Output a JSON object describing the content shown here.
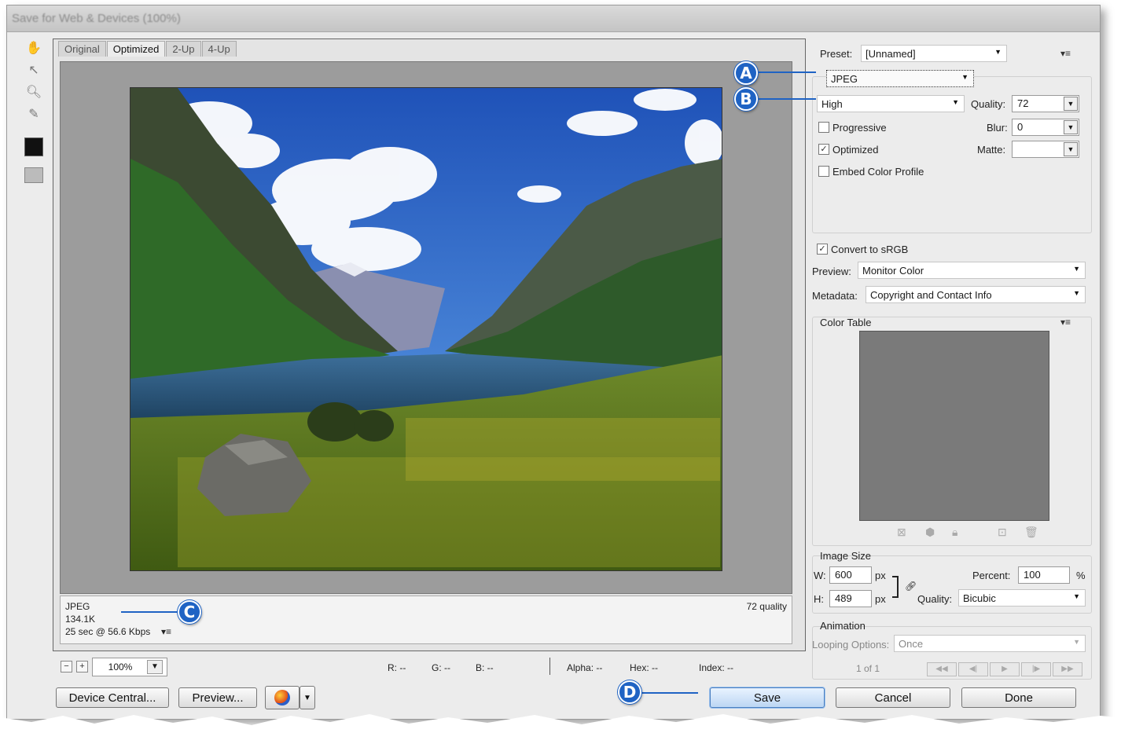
{
  "window": {
    "title": "Save for Web & Devices (100%)"
  },
  "tabs": [
    "Original",
    "Optimized",
    "2-Up",
    "4-Up"
  ],
  "info": {
    "format": "JPEG",
    "size": "134.1K",
    "time": "25 sec @ 56.6 Kbps",
    "quality_note": "72 quality"
  },
  "status_bar": {
    "zoom": "100%",
    "r": "R: --",
    "g": "G: --",
    "b": "B: --",
    "alpha": "Alpha: --",
    "hex": "Hex: --",
    "index": "Index: --"
  },
  "buttons": {
    "device_central": "Device Central...",
    "preview": "Preview...",
    "save": "Save",
    "cancel": "Cancel",
    "done": "Done"
  },
  "settings": {
    "preset_label": "Preset:",
    "preset_value": "[Unnamed]",
    "format": "JPEG",
    "quality_level": "High",
    "quality_label": "Quality:",
    "quality_value": "72",
    "blur_label": "Blur:",
    "blur_value": "0",
    "matte_label": "Matte:",
    "matte_value": "",
    "progressive": "Progressive",
    "optimized": "Optimized",
    "embed_profile": "Embed Color Profile",
    "convert_srgb": "Convert to sRGB",
    "preview_label": "Preview:",
    "preview_value": "Monitor Color",
    "metadata_label": "Metadata:",
    "metadata_value": "Copyright and Contact Info"
  },
  "color_table": {
    "title": "Color Table"
  },
  "image_size": {
    "title": "Image Size",
    "w_label": "W:",
    "w_value": "600",
    "h_label": "H:",
    "h_value": "489",
    "unit": "px",
    "percent_label": "Percent:",
    "percent_value": "100",
    "percent_unit": "%",
    "quality_label": "Quality:",
    "quality_value": "Bicubic"
  },
  "animation": {
    "title": "Animation",
    "looping_label": "Looping Options:",
    "looping_value": "Once",
    "frame": "1 of 1"
  },
  "callouts": {
    "a": "A",
    "b": "B",
    "c": "C",
    "d": "D"
  }
}
